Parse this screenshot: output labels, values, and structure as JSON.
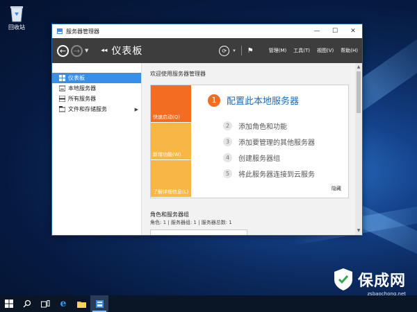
{
  "desktop": {
    "recycle_bin_label": "回收站"
  },
  "window": {
    "title": "服务器管理器",
    "controls": {
      "minimize": "—",
      "maximize": "☐",
      "close": "✕"
    }
  },
  "header": {
    "page_title": "仪表板",
    "menu": [
      "管理(M)",
      "工具(T)",
      "视图(V)",
      "帮助(H)"
    ]
  },
  "sidebar": {
    "items": [
      {
        "label": "仪表板",
        "active": true
      },
      {
        "label": "本地服务器",
        "active": false
      },
      {
        "label": "所有服务器",
        "active": false
      },
      {
        "label": "文件和存储服务",
        "active": false,
        "has_submenu": true
      }
    ]
  },
  "main": {
    "welcome": "欢迎使用服务器管理器",
    "tiles": [
      "快速启动(Q)",
      "新增功能(W)",
      "了解详细信息(L)"
    ],
    "steps": [
      {
        "num": "1",
        "label": "配置此本地服务器"
      },
      {
        "num": "2",
        "label": "添加角色和功能"
      },
      {
        "num": "3",
        "label": "添加要管理的其他服务器"
      },
      {
        "num": "4",
        "label": "创建服务器组"
      },
      {
        "num": "5",
        "label": "将此服务器连接到云服务"
      }
    ],
    "hide": "隐藏",
    "roles_title": "角色和服务器组",
    "roles_summary": "角色: 1 | 服务器组: 1 | 服务器总数: 1"
  },
  "taskbar": {
    "icons": [
      "windows-start-icon",
      "search-icon",
      "task-view-icon",
      "internet-explorer-icon",
      "file-explorer-icon",
      "server-manager-icon"
    ]
  },
  "watermark": {
    "brand": "保成网",
    "url": "zsbaochong.net"
  },
  "colors": {
    "accent": "#f26c21",
    "tile_yellow": "#f8b745",
    "link_blue": "#1a6ab8",
    "selection": "#3a8ee6",
    "header_bg": "#3d3d3d"
  }
}
